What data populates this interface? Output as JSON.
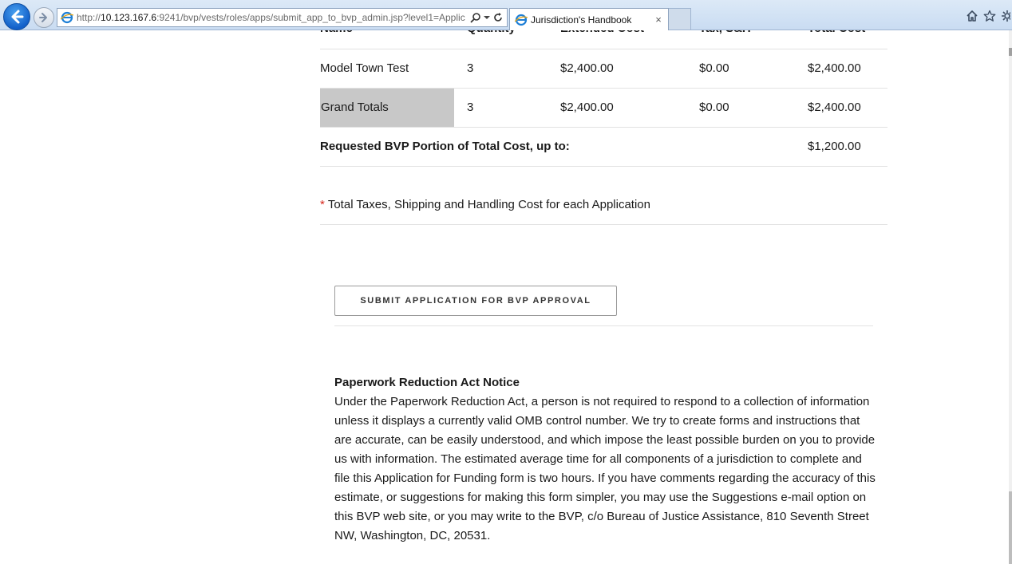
{
  "browser": {
    "url_prefix": "http://",
    "url_host": "10.123.167.6",
    "url_rest": ":9241/bvp/vests/roles/apps/submit_app_to_bvp_admin.jsp?level1=Applic",
    "tab_title": "Jurisdiction's Handbook",
    "tab_close": "×"
  },
  "table": {
    "headers": [
      "Name",
      "Quantity",
      "Extended Cost",
      "Tax, S&H",
      "Total Cost"
    ],
    "rows": [
      {
        "name": "Model Town Test",
        "quantity": "3",
        "extended": "$2,400.00",
        "tax": "$0.00",
        "total": "$2,400.00"
      }
    ],
    "grand": {
      "label": "Grand Totals",
      "quantity": "3",
      "extended": "$2,400.00",
      "tax": "$0.00",
      "total": "$2,400.00"
    },
    "requested": {
      "label": "Requested BVP Portion of Total Cost, up to:",
      "value": "$1,200.00"
    }
  },
  "note": {
    "asterisk": "*",
    "text": "Total Taxes, Shipping and Handling Cost for each Application"
  },
  "submit": {
    "label": "SUBMIT APPLICATION FOR BVP APPROVAL"
  },
  "notice": {
    "title": "Paperwork Reduction Act Notice",
    "body": "Under the Paperwork Reduction Act, a person is not required to respond to a collection of information unless it displays a currently valid OMB control number. We try to create forms and instructions that are accurate, can be easily understood, and which impose the least possible burden on you to provide us with information. The estimated average time for all components of a jurisdiction to complete and file this Application for Funding form is two hours. If you have comments regarding the accuracy of this estimate, or suggestions for making this form simpler, you may use the Suggestions e-mail option on this BVP web site, or you may write to the BVP, c/o Bureau of Justice Assistance, 810 Seventh Street NW, Washington, DC, 20531."
  },
  "colors": {
    "chrome": "#c9dcf2",
    "grand_bg": "#c8c8c8",
    "asterisk": "#d6261c",
    "rule": "#e2e2e2"
  }
}
